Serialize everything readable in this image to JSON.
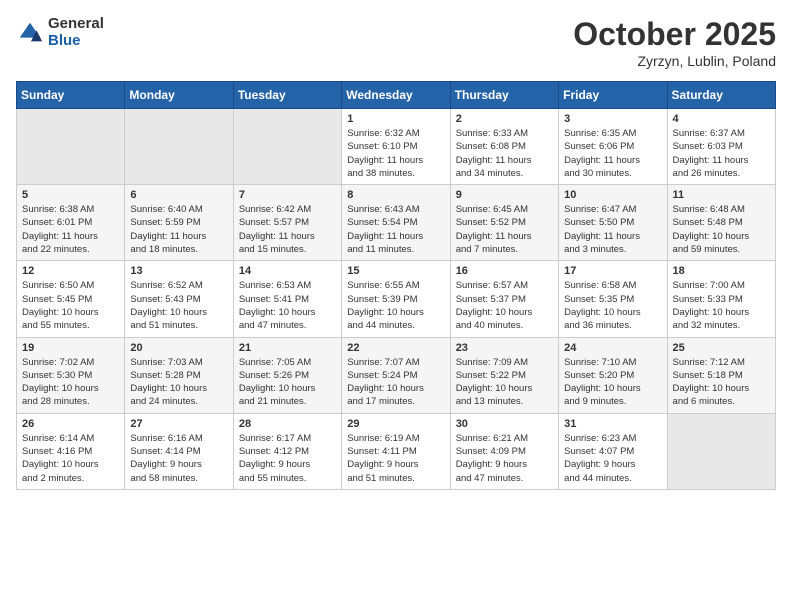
{
  "logo": {
    "general": "General",
    "blue": "Blue"
  },
  "title": "October 2025",
  "location": "Zyrzyn, Lublin, Poland",
  "days_of_week": [
    "Sunday",
    "Monday",
    "Tuesday",
    "Wednesday",
    "Thursday",
    "Friday",
    "Saturday"
  ],
  "weeks": [
    [
      {
        "day": "",
        "info": ""
      },
      {
        "day": "",
        "info": ""
      },
      {
        "day": "",
        "info": ""
      },
      {
        "day": "1",
        "info": "Sunrise: 6:32 AM\nSunset: 6:10 PM\nDaylight: 11 hours\nand 38 minutes."
      },
      {
        "day": "2",
        "info": "Sunrise: 6:33 AM\nSunset: 6:08 PM\nDaylight: 11 hours\nand 34 minutes."
      },
      {
        "day": "3",
        "info": "Sunrise: 6:35 AM\nSunset: 6:06 PM\nDaylight: 11 hours\nand 30 minutes."
      },
      {
        "day": "4",
        "info": "Sunrise: 6:37 AM\nSunset: 6:03 PM\nDaylight: 11 hours\nand 26 minutes."
      }
    ],
    [
      {
        "day": "5",
        "info": "Sunrise: 6:38 AM\nSunset: 6:01 PM\nDaylight: 11 hours\nand 22 minutes."
      },
      {
        "day": "6",
        "info": "Sunrise: 6:40 AM\nSunset: 5:59 PM\nDaylight: 11 hours\nand 18 minutes."
      },
      {
        "day": "7",
        "info": "Sunrise: 6:42 AM\nSunset: 5:57 PM\nDaylight: 11 hours\nand 15 minutes."
      },
      {
        "day": "8",
        "info": "Sunrise: 6:43 AM\nSunset: 5:54 PM\nDaylight: 11 hours\nand 11 minutes."
      },
      {
        "day": "9",
        "info": "Sunrise: 6:45 AM\nSunset: 5:52 PM\nDaylight: 11 hours\nand 7 minutes."
      },
      {
        "day": "10",
        "info": "Sunrise: 6:47 AM\nSunset: 5:50 PM\nDaylight: 11 hours\nand 3 minutes."
      },
      {
        "day": "11",
        "info": "Sunrise: 6:48 AM\nSunset: 5:48 PM\nDaylight: 10 hours\nand 59 minutes."
      }
    ],
    [
      {
        "day": "12",
        "info": "Sunrise: 6:50 AM\nSunset: 5:45 PM\nDaylight: 10 hours\nand 55 minutes."
      },
      {
        "day": "13",
        "info": "Sunrise: 6:52 AM\nSunset: 5:43 PM\nDaylight: 10 hours\nand 51 minutes."
      },
      {
        "day": "14",
        "info": "Sunrise: 6:53 AM\nSunset: 5:41 PM\nDaylight: 10 hours\nand 47 minutes."
      },
      {
        "day": "15",
        "info": "Sunrise: 6:55 AM\nSunset: 5:39 PM\nDaylight: 10 hours\nand 44 minutes."
      },
      {
        "day": "16",
        "info": "Sunrise: 6:57 AM\nSunset: 5:37 PM\nDaylight: 10 hours\nand 40 minutes."
      },
      {
        "day": "17",
        "info": "Sunrise: 6:58 AM\nSunset: 5:35 PM\nDaylight: 10 hours\nand 36 minutes."
      },
      {
        "day": "18",
        "info": "Sunrise: 7:00 AM\nSunset: 5:33 PM\nDaylight: 10 hours\nand 32 minutes."
      }
    ],
    [
      {
        "day": "19",
        "info": "Sunrise: 7:02 AM\nSunset: 5:30 PM\nDaylight: 10 hours\nand 28 minutes."
      },
      {
        "day": "20",
        "info": "Sunrise: 7:03 AM\nSunset: 5:28 PM\nDaylight: 10 hours\nand 24 minutes."
      },
      {
        "day": "21",
        "info": "Sunrise: 7:05 AM\nSunset: 5:26 PM\nDaylight: 10 hours\nand 21 minutes."
      },
      {
        "day": "22",
        "info": "Sunrise: 7:07 AM\nSunset: 5:24 PM\nDaylight: 10 hours\nand 17 minutes."
      },
      {
        "day": "23",
        "info": "Sunrise: 7:09 AM\nSunset: 5:22 PM\nDaylight: 10 hours\nand 13 minutes."
      },
      {
        "day": "24",
        "info": "Sunrise: 7:10 AM\nSunset: 5:20 PM\nDaylight: 10 hours\nand 9 minutes."
      },
      {
        "day": "25",
        "info": "Sunrise: 7:12 AM\nSunset: 5:18 PM\nDaylight: 10 hours\nand 6 minutes."
      }
    ],
    [
      {
        "day": "26",
        "info": "Sunrise: 6:14 AM\nSunset: 4:16 PM\nDaylight: 10 hours\nand 2 minutes."
      },
      {
        "day": "27",
        "info": "Sunrise: 6:16 AM\nSunset: 4:14 PM\nDaylight: 9 hours\nand 58 minutes."
      },
      {
        "day": "28",
        "info": "Sunrise: 6:17 AM\nSunset: 4:12 PM\nDaylight: 9 hours\nand 55 minutes."
      },
      {
        "day": "29",
        "info": "Sunrise: 6:19 AM\nSunset: 4:11 PM\nDaylight: 9 hours\nand 51 minutes."
      },
      {
        "day": "30",
        "info": "Sunrise: 6:21 AM\nSunset: 4:09 PM\nDaylight: 9 hours\nand 47 minutes."
      },
      {
        "day": "31",
        "info": "Sunrise: 6:23 AM\nSunset: 4:07 PM\nDaylight: 9 hours\nand 44 minutes."
      },
      {
        "day": "",
        "info": ""
      }
    ]
  ]
}
